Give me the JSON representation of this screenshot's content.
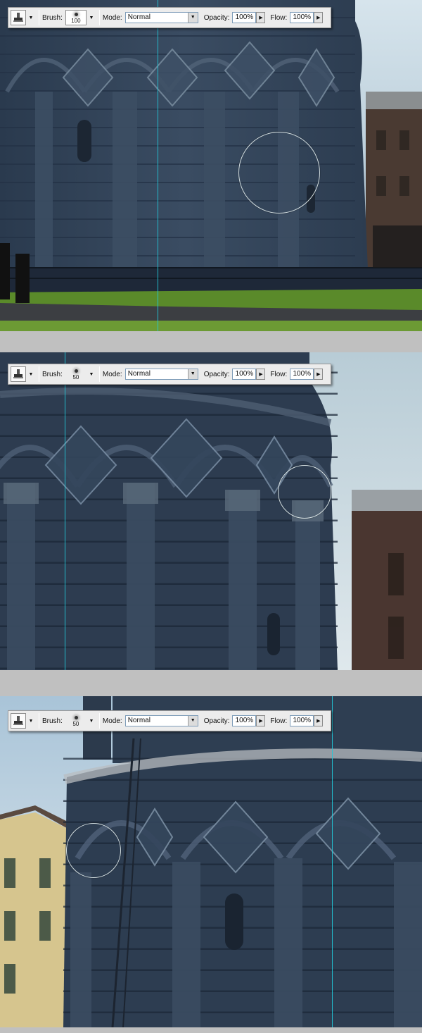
{
  "colors": {
    "guide": "#22c8d8",
    "background": "#c0c0c0",
    "toolbar": "#ececec"
  },
  "panels": [
    {
      "toolbar": {
        "tool_icon": "clone-stamp-icon",
        "brush_label": "Brush:",
        "brush_size": "100",
        "mode_label": "Mode:",
        "mode_value": "Normal",
        "opacity_label": "Opacity:",
        "opacity_value": "100%",
        "flow_label": "Flow:",
        "flow_value": "100%"
      }
    },
    {
      "toolbar": {
        "tool_icon": "clone-stamp-icon",
        "brush_label": "Brush:",
        "brush_size": "50",
        "mode_label": "Mode:",
        "mode_value": "Normal",
        "opacity_label": "Opacity:",
        "opacity_value": "100%",
        "flow_label": "Flow:",
        "flow_value": "100%"
      }
    },
    {
      "toolbar": {
        "tool_icon": "clone-stamp-icon",
        "brush_label": "Brush:",
        "brush_size": "50",
        "mode_label": "Mode:",
        "mode_value": "Normal",
        "opacity_label": "Opacity:",
        "opacity_value": "100%",
        "flow_label": "Flow:",
        "flow_value": "100%"
      }
    }
  ]
}
